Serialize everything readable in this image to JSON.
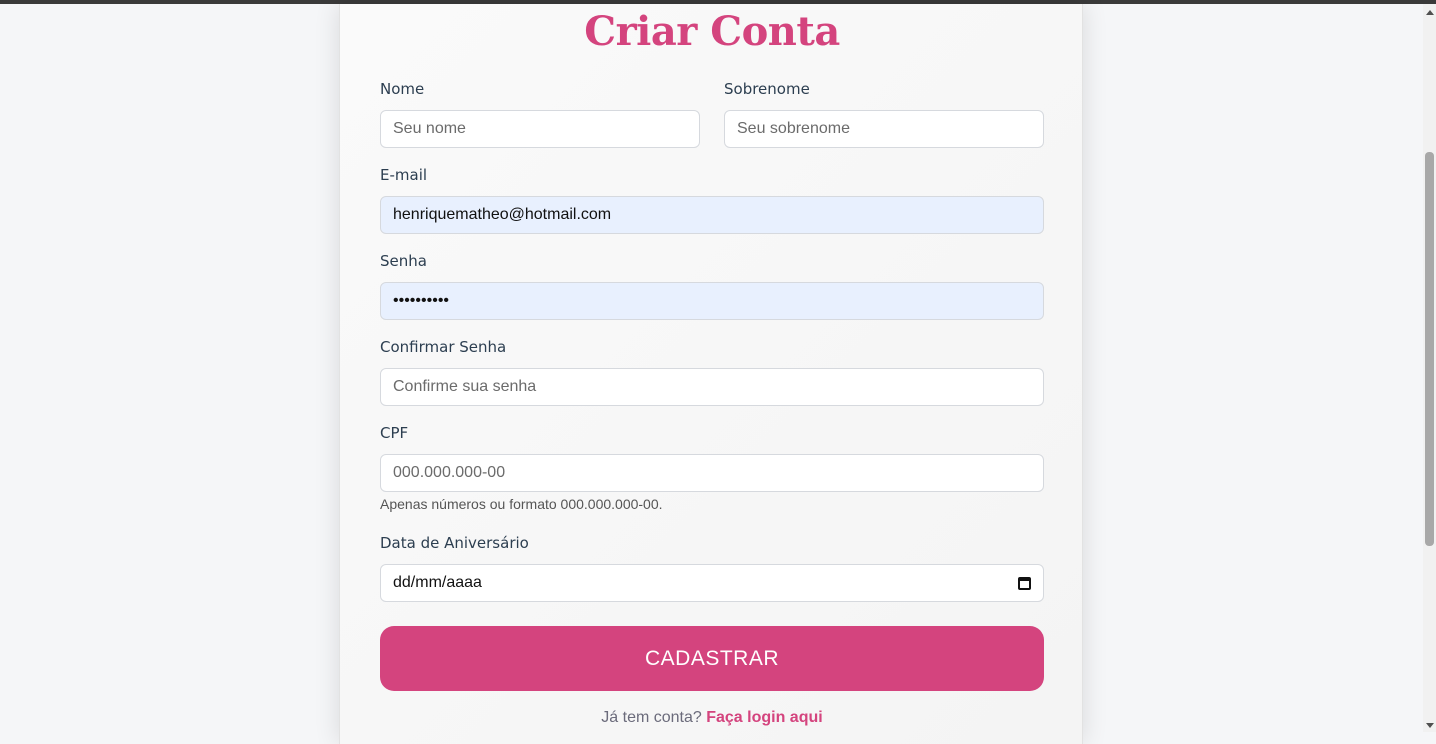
{
  "form": {
    "title": "Criar Conta",
    "nome": {
      "label": "Nome",
      "placeholder": "Seu nome"
    },
    "sobrenome": {
      "label": "Sobrenome",
      "placeholder": "Seu sobrenome"
    },
    "email": {
      "label": "E-mail",
      "value": "henriquematheo@hotmail.com"
    },
    "senha": {
      "label": "Senha",
      "value": "••••••••••"
    },
    "confirmar": {
      "label": "Confirmar Senha",
      "placeholder": "Confirme sua senha"
    },
    "cpf": {
      "label": "CPF",
      "placeholder": "000.000.000-00",
      "hint": "Apenas números ou formato 000.000.000-00."
    },
    "aniversario": {
      "label": "Data de Aniversário",
      "placeholder": "dd/mm/aaaa",
      "icon": "calendar-icon"
    },
    "submit_label": "CADASTRAR",
    "footer_text": "Já tem conta?",
    "footer_link": "Faça login aqui"
  },
  "colors": {
    "accent": "#d4447e",
    "autofill": "#e8f0fe"
  }
}
